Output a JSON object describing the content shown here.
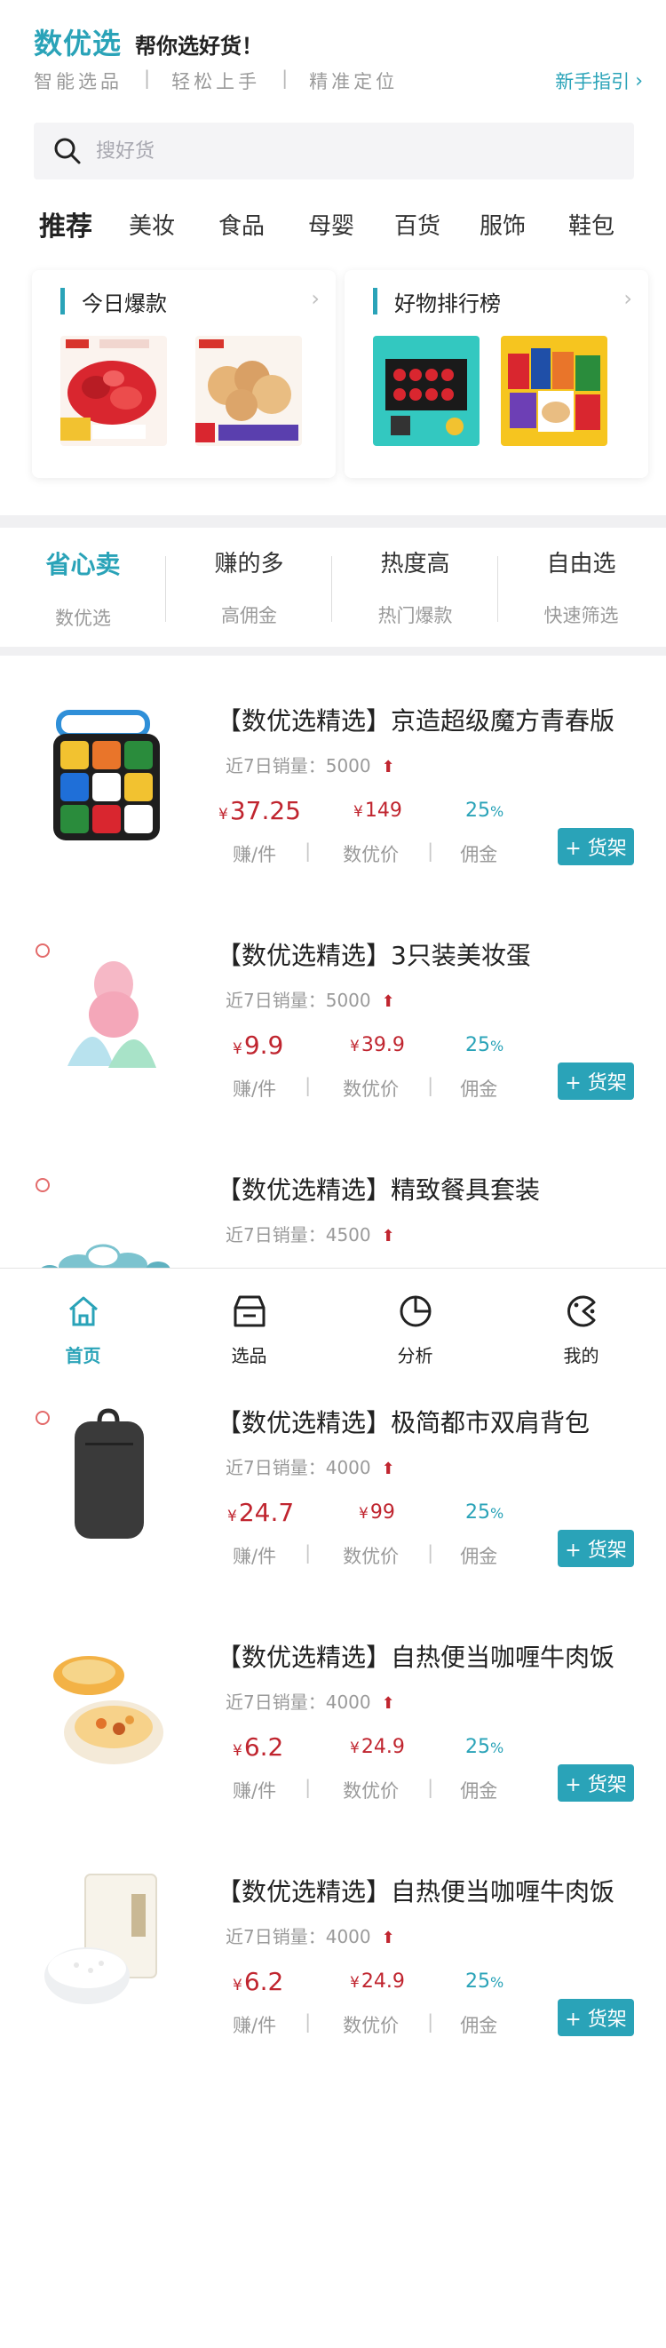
{
  "header": {
    "brand": "数优选",
    "slogan": "帮你选好货！",
    "features": [
      "智能选品",
      "轻松上手",
      "精准定位"
    ],
    "guide_label": "新手指引"
  },
  "search": {
    "placeholder": "搜好货"
  },
  "categories": [
    "推荐",
    "美妆",
    "食品",
    "母婴",
    "百货",
    "服饰",
    "鞋包"
  ],
  "promo_cards": [
    {
      "title": "今日爆款"
    },
    {
      "title": "好物排行榜"
    }
  ],
  "sort_tabs": [
    {
      "title": "省心卖",
      "sub": "数优选"
    },
    {
      "title": "赚的多",
      "sub": "高佣金"
    },
    {
      "title": "热度高",
      "sub": "热门爆款"
    },
    {
      "title": "自由选",
      "sub": "快速筛选"
    }
  ],
  "labels": {
    "earn": "赚/件",
    "price": "数优价",
    "commission": "佣金",
    "shelf": "+ 货架",
    "currency": "¥",
    "percent": "%",
    "sep": "|"
  },
  "products": [
    {
      "title": "【数优选精选】京造超级魔方青春版",
      "sales": "近7日销量：5000",
      "earn": "37.25",
      "price": "149",
      "commission": "25"
    },
    {
      "title": "【数优选精选】3只装美妆蛋",
      "sales": "近7日销量：5000",
      "earn": "9.9",
      "price": "39.9",
      "commission": "25"
    },
    {
      "title": "【数优选精选】精致餐具套装",
      "sales": "近7日销量：4500"
    },
    {
      "title": "【数优选精选】极简都市双肩背包",
      "sales": "近7日销量：4000",
      "earn": "24.7",
      "price": "99",
      "commission": "25"
    },
    {
      "title": "【数优选精选】自热便当咖喱牛肉饭",
      "sales": "近7日销量：4000",
      "earn": "6.2",
      "price": "24.9",
      "commission": "25"
    },
    {
      "title": "【数优选精选】自热便当咖喱牛肉饭",
      "sales": "近7日销量：4000",
      "earn": "6.2",
      "price": "24.9",
      "commission": "25"
    }
  ],
  "bottom_nav": [
    {
      "label": "首页",
      "icon": "home-icon"
    },
    {
      "label": "选品",
      "icon": "box-icon"
    },
    {
      "label": "分析",
      "icon": "pie-chart-icon"
    },
    {
      "label": "我的",
      "icon": "profile-icon"
    }
  ],
  "colors": {
    "accent": "#2aa3b8",
    "price_red": "#c0252f",
    "divider": "#f0f0f2"
  }
}
